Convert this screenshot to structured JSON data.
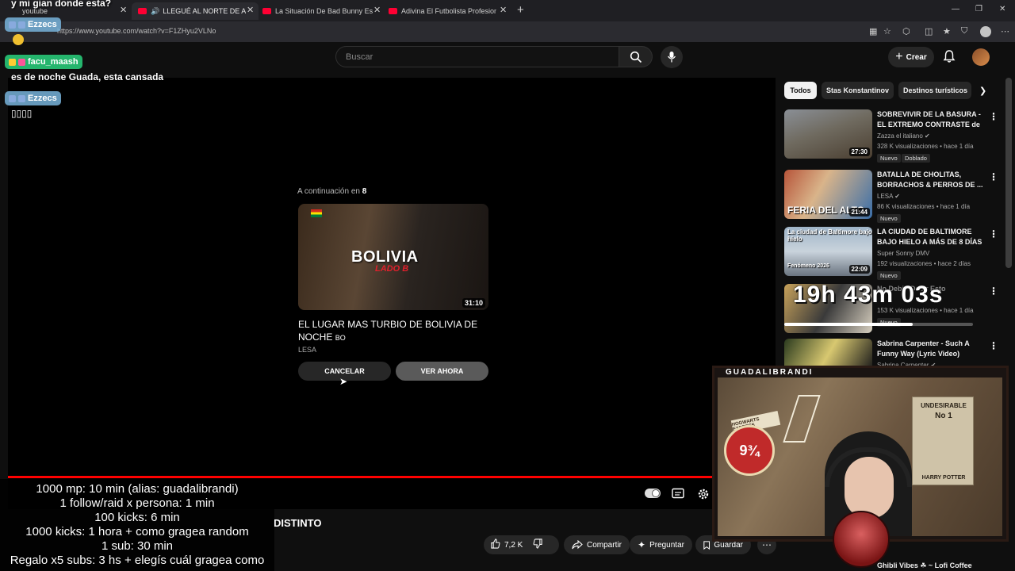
{
  "browser": {
    "tabs": [
      {
        "title": "youtube"
      },
      {
        "title": "LLEGUÉ AL NORTE DE ARGEN"
      },
      {
        "title": "La Situación De Bad Bunny Es Trist"
      },
      {
        "title": "Adivina El Futbolista Profesional c"
      }
    ],
    "url": "https://www.youtube.com/watch?v=F1ZHyu2VLNo"
  },
  "header": {
    "search_placeholder": "Buscar",
    "create_label": "Crear"
  },
  "player": {
    "up_next_label": "A continuación en",
    "countdown": "8",
    "next_video": {
      "thumb_text": "BOLIVIA",
      "thumb_subtext": "LADO B",
      "duration": "31:10",
      "title": "EL LUGAR MAS TURBIO DE BOLIVIA DE NOCHE",
      "title_suffix": "BO",
      "channel": "LESA"
    },
    "cancel_label": "CANCELAR",
    "watch_label": "VER AHORA"
  },
  "below": {
    "title_fragment": "DISTINTO",
    "like_count": "7,2 K",
    "share_label": "Compartir",
    "ask_label": "Preguntar",
    "save_label": "Guardar"
  },
  "sidebar": {
    "chips": [
      "Todos",
      "Stas Konstantinov",
      "Destinos turísticos"
    ],
    "videos": [
      {
        "title": "SOBREVIVIR DE LA BASURA - EL EXTREMO CONTRASTE de ...",
        "channel": "Zazza el italiano",
        "meta": "328 K visualizaciones • hace 1 día",
        "badge": "Nuevo",
        "badge2": "Doblado",
        "duration": "27:30",
        "thumb_text": ""
      },
      {
        "title": "BATALLA DE CHOLITAS, BORRACHOS & PERROS DE ...",
        "channel": "LESA",
        "meta": "86 K visualizaciones • hace 1 día",
        "badge": "Nuevo",
        "duration": "21:44",
        "thumb_text": "FERIA DEL ALTO"
      },
      {
        "title": "LA CIUDAD DE BALTIMORE BAJO HIELO  A MÁS DE 8 DÍAS",
        "channel": "Super Sonny DMV",
        "meta": "192 visualizaciones • hace 2 días",
        "badge": "Nuevo",
        "duration": "22:09",
        "thumb_text": "La ciudad de Baltimore bajo hielo",
        "thumb_text2": "Fenómeno 2026"
      },
      {
        "title": "No Debió Decir Esto",
        "channel": "",
        "meta": "153 K visualizaciones • hace 1 día",
        "badge": "Nuevo",
        "duration": "",
        "thumb_text": ""
      },
      {
        "title": "Sabrina Carpenter - Such A Funny Way (Lyric Video)",
        "channel": "Sabrina Carpenter",
        "meta": "",
        "badge": "",
        "duration": "",
        "thumb_text": ""
      },
      {
        "title": "Ghibli Vibes ☘ ~ Lofi Coffee",
        "channel": "",
        "meta": "",
        "badge": "",
        "duration": "",
        "thumb_text": ""
      }
    ]
  },
  "overlay": {
    "top_message": "y mi gian donde esta?",
    "chat": [
      {
        "user": "Ezzecs",
        "message": ""
      },
      {
        "user": "facu_maash",
        "message": "es de noche Guada, esta cansada"
      },
      {
        "user": "Ezzecs",
        "message": "▯▯▯▯"
      }
    ],
    "timer": "19h 43m 03s",
    "timer_progress": 0.68,
    "rules": [
      "1000 mp: 10 min (alias: guadalibrandi)",
      "1 follow/raid x persona: 1 min",
      "100 kicks: 6 min",
      "1000 kicks: 1 hora + como gragea random",
      "1 sub: 30 min",
      "Regalo x5 subs: 3 hs + elegís cuál gragea como"
    ],
    "streamer_name": "GUADALIBRANDI",
    "cam": {
      "poster_line1": "UNDESIRABLE",
      "poster_line2": "No 1",
      "poster_line3": "HARRY POTTER",
      "platform": "9¾",
      "hogwarts": "HOGWARTS EXPRESS"
    }
  },
  "colors": {
    "accent": "#ff0000",
    "chat_green": "#28c878",
    "chat_blue": "#78b4dc"
  }
}
